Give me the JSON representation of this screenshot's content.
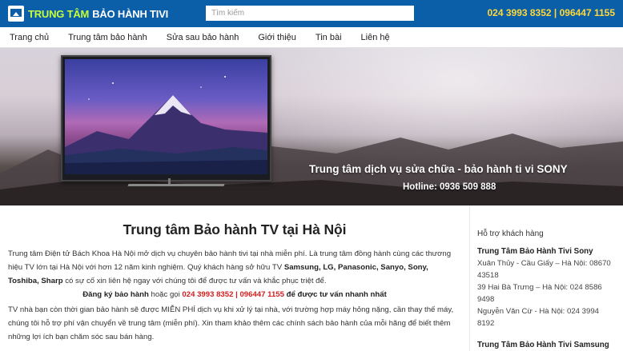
{
  "header": {
    "logo_part1": "TRUNG TÂM",
    "logo_part2": "BẢO HÀNH TIVI",
    "search_placeholder": "Tìm kiếm",
    "hotline": "024 3993 8352 | 096447 1155",
    "colors": {
      "bar": "#0b5ea8",
      "logo_accent": "#c6ff3a",
      "hotline": "#ffd83a"
    }
  },
  "nav": {
    "items": [
      {
        "label": "Trang chủ"
      },
      {
        "label": "Trung tâm bảo hành"
      },
      {
        "label": "Sửa sau bảo hành"
      },
      {
        "label": "Giới thiệu"
      },
      {
        "label": "Tin bài"
      },
      {
        "label": "Liên hệ"
      }
    ]
  },
  "banner": {
    "title": "Trung tâm dịch vụ sửa chữa - bảo hành ti vi SONY",
    "hotline": "Hotline: 0936 509 888"
  },
  "main": {
    "heading": "Trung tâm Bảo hành TV tại Hà Nội",
    "intro_text": "Trung tâm Điện tử Bách Khoa Hà Nội mở dịch vụ chuyên bảo hành tivi tại nhà miễn phí. Là trung tâm đồng hành cùng các thương hiệu TV lớn tại Hà Nội với hơn 12 năm kinh nghiệm. Quý khách hàng sở hữu TV",
    "brands": "Samsung, LG, Panasonic, Sanyo, Sony, Toshiba, Sharp",
    "intro_tail": " có sự cố xin liên hệ ngay với chúng tôi để được tư vấn và khắc phục triệt để.",
    "register_label": "Đăng ký bảo hành",
    "register_mid": " hoặc gọi ",
    "register_phone": "024 3993 8352 | 096447 1155",
    "register_tail": " để được tư vấn nhanh nhất",
    "policy_text": "TV nhà bạn còn thời gian bảo hành sẽ được MIỄN PHÍ dịch vụ khi xử lý tại nhà, với trường hợp máy hỏng nặng, cần thay thế máy, chúng tôi hỗ trợ phí vận chuyển về trung tâm (miễn phí). Xin tham khảo thêm các chính sách bảo hành của mỗi hãng để biết thêm những lợi ích bạn chăm sóc sau bán hàng."
  },
  "sidebar": {
    "heading": "Hỗ trợ khách hàng",
    "sony_title": "Trung Tâm Bảo Hành Tivi Sony",
    "sony_lines": [
      "Xuân Thủy - Cầu Giấy – Hà Nội: 08670 43518",
      "39 Hai Bà Trưng – Hà Nội: 024 8586 9498",
      "Nguyễn Văn Cừ - Hà Nội: 024 3994 8192"
    ],
    "samsung_title": "Trung Tâm Bảo Hành Tivi Samsung"
  }
}
